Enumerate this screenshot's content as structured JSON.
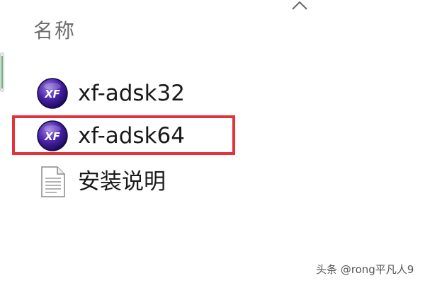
{
  "header": {
    "sort_icon": "chevron-up-icon",
    "name_column": "名称"
  },
  "files": [
    {
      "name": "xf-adsk32",
      "icon": "xf-keygen-app-icon",
      "highlighted": false
    },
    {
      "name": "xf-adsk64",
      "icon": "xf-keygen-app-icon",
      "highlighted": true
    },
    {
      "name": "安装说明",
      "icon": "text-document-icon",
      "highlighted": false
    }
  ],
  "highlight_color": "#e5323a",
  "watermark": "头条 @rong平凡人9"
}
